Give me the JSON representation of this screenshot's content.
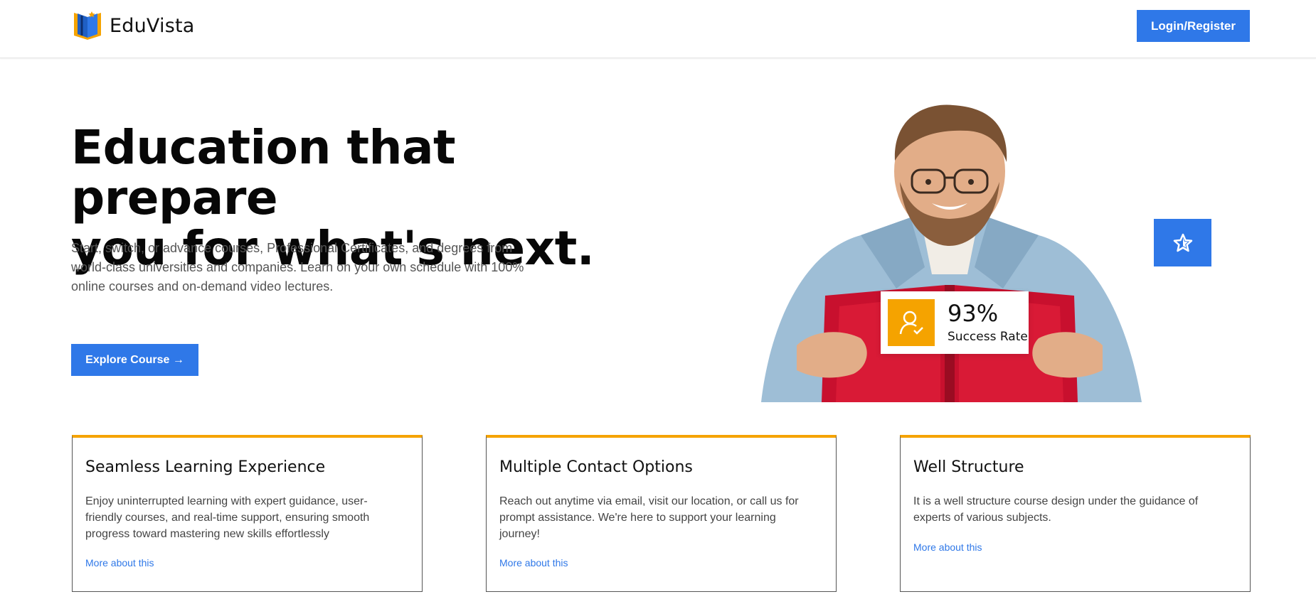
{
  "header": {
    "brand": "EduVista",
    "login_label": "Login/Register"
  },
  "hero": {
    "title_line1": "Education that prepare",
    "title_line2": "you for what's next.",
    "description": "Start, switch, or advance courses, Professional Certificates, and degrees from world-class universities and companies. Learn on your own schedule with 100% online courses and on-demand video lectures.",
    "explore_label": "Explore Course →",
    "stat_value": "93%",
    "stat_label": "Success Rate"
  },
  "cards": [
    {
      "title": "Seamless Learning Experience",
      "text": "Enjoy uninterrupted learning with expert guidance, user-friendly courses, and real-time support, ensuring smooth progress toward mastering new skills effortlessly",
      "link": "More about this"
    },
    {
      "title": "Multiple Contact Options",
      "text": "Reach out anytime via email, visit our location, or call us for prompt assistance. We're here to support your learning journey!",
      "link": "More about this"
    },
    {
      "title": "Well Structure",
      "text": "It is a well structure course design under the guidance of experts of various subjects.",
      "link": "More about this"
    }
  ],
  "colors": {
    "primary": "#2f78e8",
    "accent": "#f5a300",
    "book": "#c8102e"
  },
  "icons": {
    "logo": "open-book-icon",
    "stat": "user-check-icon",
    "badge": "star-icon"
  }
}
